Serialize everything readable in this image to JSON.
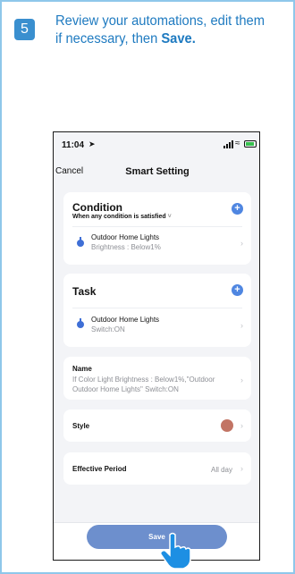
{
  "step": {
    "number": "5",
    "text": "Review your automations, edit them if necessary, then ",
    "bold": "Save."
  },
  "statusbar": {
    "time": "11:04",
    "icons": [
      "location-arrow-icon",
      "signal-icon",
      "wifi-icon",
      "battery-icon"
    ]
  },
  "nav": {
    "cancel": "Cancel",
    "title": "Smart Setting"
  },
  "condition": {
    "title": "Condition",
    "subtitle": "When any condition is satisfied",
    "item": {
      "name": "Outdoor Home Lights",
      "detail": "Brightness : Below1%"
    }
  },
  "task": {
    "title": "Task",
    "item": {
      "name": "Outdoor Home Lights",
      "detail": "Switch:ON"
    }
  },
  "name_row": {
    "label": "Name",
    "value": "If Color Light Brightness : Below1%,\"Outdoor Outdoor Home Lights\" Switch:ON"
  },
  "style_row": {
    "label": "Style",
    "color": "#c27464"
  },
  "period_row": {
    "label": "Effective Period",
    "value": "All day"
  },
  "save_button": "Save",
  "colors": {
    "accent": "#4f86e1",
    "save": "#6d8fcd",
    "instruction": "#1e7ac0",
    "frame_border": "#8fc7ea"
  }
}
